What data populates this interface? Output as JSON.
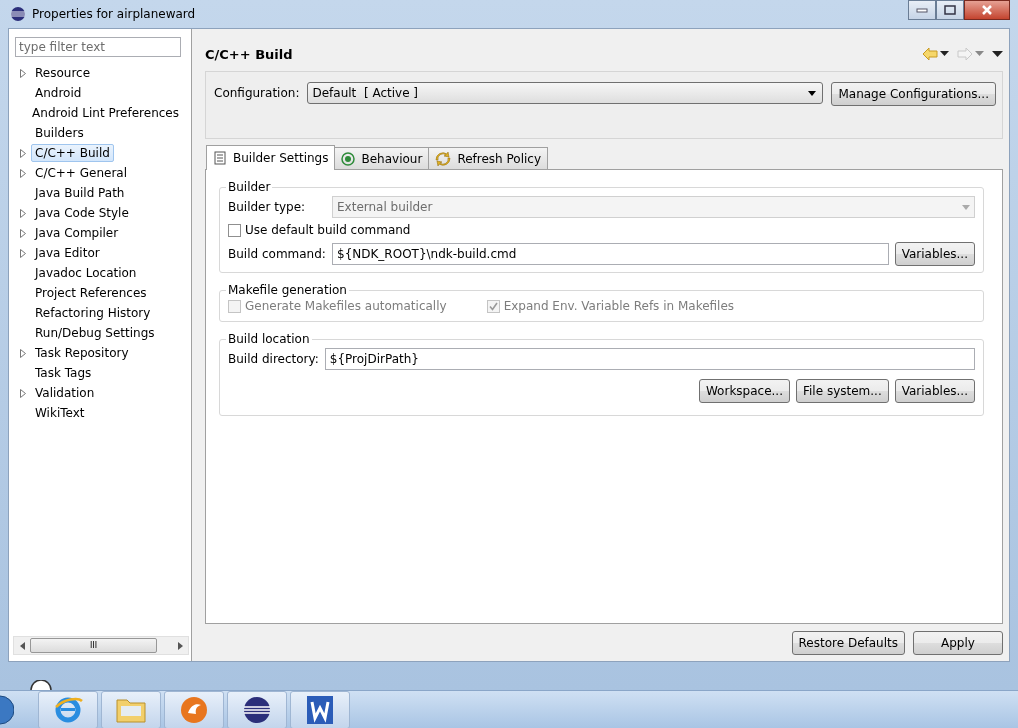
{
  "window": {
    "title": "Properties for airplaneward"
  },
  "filter": {
    "placeholder": "type filter text"
  },
  "tree": [
    {
      "label": "Resource",
      "expandable": true,
      "selected": false
    },
    {
      "label": "Android",
      "expandable": false,
      "selected": false
    },
    {
      "label": "Android Lint Preferences",
      "expandable": false,
      "selected": false
    },
    {
      "label": "Builders",
      "expandable": false,
      "selected": false
    },
    {
      "label": "C/C++ Build",
      "expandable": true,
      "selected": true
    },
    {
      "label": "C/C++ General",
      "expandable": true,
      "selected": false
    },
    {
      "label": "Java Build Path",
      "expandable": false,
      "selected": false
    },
    {
      "label": "Java Code Style",
      "expandable": true,
      "selected": false
    },
    {
      "label": "Java Compiler",
      "expandable": true,
      "selected": false
    },
    {
      "label": "Java Editor",
      "expandable": true,
      "selected": false
    },
    {
      "label": "Javadoc Location",
      "expandable": false,
      "selected": false
    },
    {
      "label": "Project References",
      "expandable": false,
      "selected": false
    },
    {
      "label": "Refactoring History",
      "expandable": false,
      "selected": false
    },
    {
      "label": "Run/Debug Settings",
      "expandable": false,
      "selected": false
    },
    {
      "label": "Task Repository",
      "expandable": true,
      "selected": false
    },
    {
      "label": "Task Tags",
      "expandable": false,
      "selected": false
    },
    {
      "label": "Validation",
      "expandable": true,
      "selected": false
    },
    {
      "label": "WikiText",
      "expandable": false,
      "selected": false
    }
  ],
  "scrollbar_grip": "III",
  "page": {
    "title": "C/C++ Build"
  },
  "configuration": {
    "label": "Configuration:",
    "value": "Default  [ Active ]",
    "button": "Manage Configurations..."
  },
  "tabs": [
    {
      "label": "Builder Settings",
      "selected": true,
      "kind": "list"
    },
    {
      "label": "Behaviour",
      "selected": false,
      "kind": "target"
    },
    {
      "label": "Refresh Policy",
      "selected": false,
      "kind": "refresh"
    }
  ],
  "builder": {
    "title": "Builder",
    "type_label": "Builder type:",
    "type_value": "External builder",
    "default_command": {
      "label": "Use default build command",
      "checked": false
    },
    "command_label": "Build command:",
    "command_value": "${NDK_ROOT}\\ndk-build.cmd",
    "variables_button": "Variables..."
  },
  "makefile": {
    "title": "Makefile generation",
    "options": [
      {
        "label": "Generate Makefiles automatically",
        "checked": false,
        "disabled": true
      },
      {
        "label": "Expand Env. Variable Refs in Makefiles",
        "checked": true,
        "disabled": true
      }
    ]
  },
  "location": {
    "title": "Build location",
    "directory_label": "Build directory:",
    "directory_value": "${ProjDirPath}",
    "buttons": [
      "Workspace...",
      "File system...",
      "Variables..."
    ]
  },
  "footer_buttons": [
    "Restore Defaults",
    "Apply"
  ]
}
